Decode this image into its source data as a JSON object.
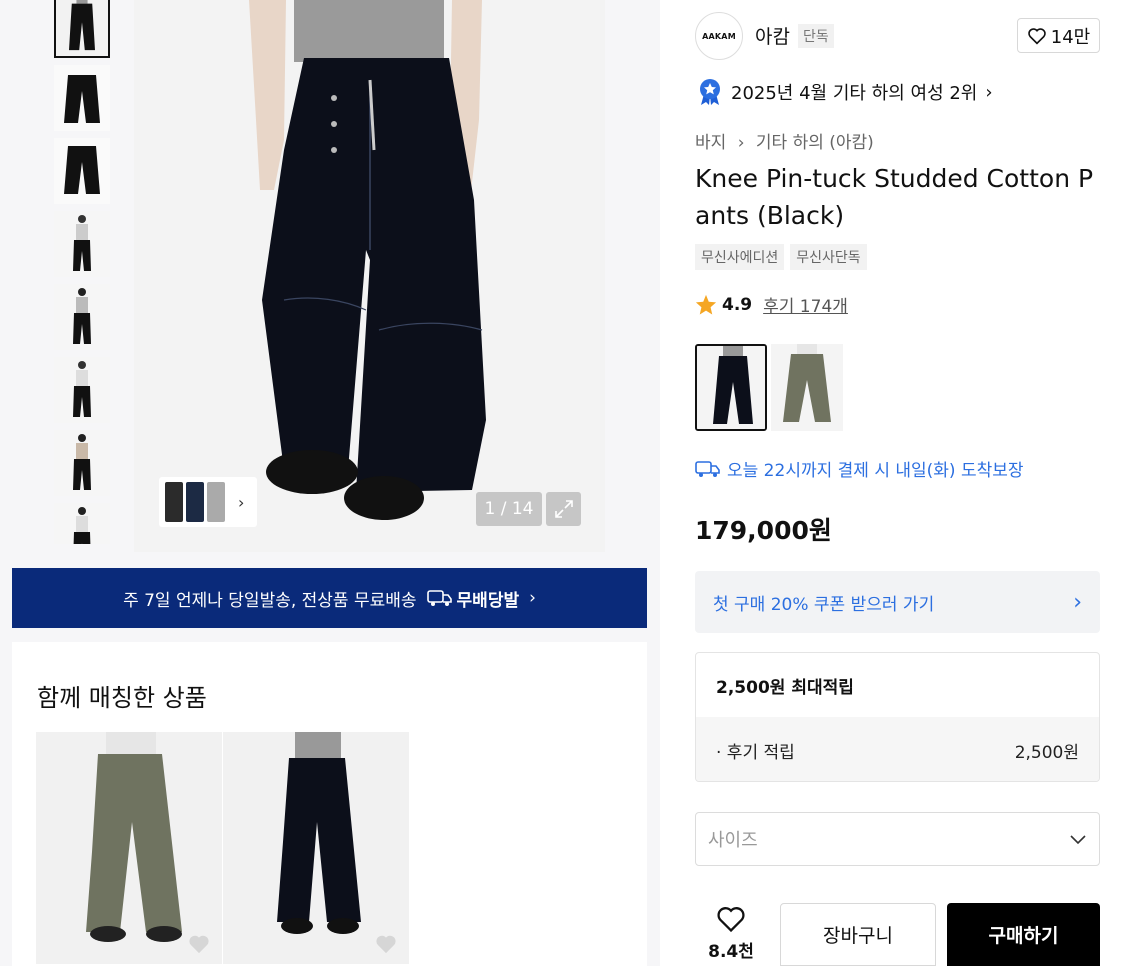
{
  "gallery": {
    "counter": "1 / 14"
  },
  "banner": {
    "text": "주 7일 언제나 당일발송, 전상품 무료배송",
    "brand": "무배당발",
    "chevron": "›"
  },
  "matched": {
    "title": "함께 매칭한 상품"
  },
  "brand": {
    "logo_text": "AAKAM",
    "name": "아캄",
    "tag": "단독"
  },
  "like": {
    "count": "14만"
  },
  "rank": {
    "text": "2025년 4월 기타 하의 여성 2위",
    "chevron": "›"
  },
  "breadcrumb": {
    "category": "바지",
    "separator": "›",
    "subcategory": "기타 하의 (아캄)"
  },
  "product": {
    "title": "Knee Pin-tuck Studded Cotton Pants (Black)",
    "tags": [
      "무신사에디션",
      "무신사단독"
    ],
    "rating": "4.9",
    "reviews": "후기 174개",
    "price": "179,000원"
  },
  "delivery": {
    "text": "오늘 22시까지 결제 시 내일(화) 도착보장"
  },
  "coupon": {
    "label": "첫 구매 20% 쿠폰 받으러 가기",
    "chevron": "›"
  },
  "points": {
    "max_label": "2,500원 최대적립",
    "review_label": "· 후기 적립",
    "review_value": "2,500원"
  },
  "size": {
    "placeholder": "사이즈"
  },
  "actions": {
    "wish_count": "8.4천",
    "cart_label": "장바구니",
    "buy_label": "구매하기"
  },
  "colors": {
    "accent_blue": "#2c6fe0",
    "banner_navy": "#0a2a7a",
    "star": "#f5a623"
  }
}
